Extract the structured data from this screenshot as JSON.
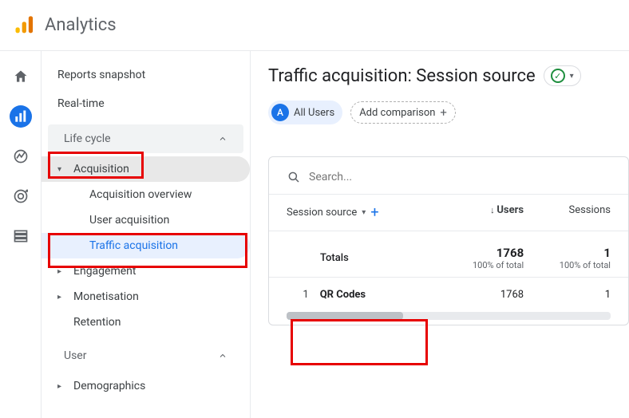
{
  "app": {
    "title": "Analytics"
  },
  "sidebar": {
    "reports_snapshot": "Reports snapshot",
    "realtime": "Real-time",
    "life_cycle": "Life cycle",
    "acquisition": "Acquisition",
    "acquisition_overview": "Acquisition overview",
    "user_acquisition": "User acquisition",
    "traffic_acquisition": "Traffic acquisition",
    "engagement": "Engagement",
    "monetisation": "Monetisation",
    "retention": "Retention",
    "user": "User",
    "demographics": "Demographics"
  },
  "main": {
    "title": "Traffic acquisition: Session source",
    "segment_label": "All Users",
    "segment_letter": "A",
    "add_comparison": "Add comparison"
  },
  "table": {
    "search_placeholder": "Search...",
    "dim_header": "Session source",
    "col_users": "Users",
    "col_sessions": "Sessions",
    "totals_label": "Totals",
    "totals_users": "1768",
    "totals_users_sub": "100% of total",
    "totals_sessions": "1",
    "totals_sessions_sub": "100% of total",
    "rows": [
      {
        "index": "1",
        "name": "QR Codes",
        "users": "1768",
        "sessions": "1"
      }
    ]
  }
}
